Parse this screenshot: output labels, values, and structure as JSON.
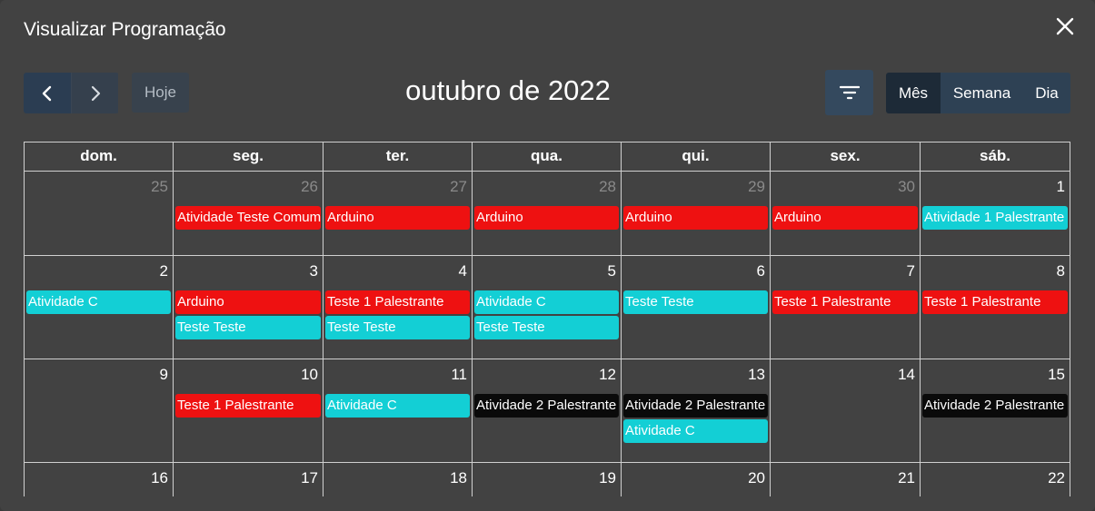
{
  "modal": {
    "title": "Visualizar Programação"
  },
  "toolbar": {
    "today_label": "Hoje",
    "title": "outubro de 2022",
    "views": [
      {
        "label": "Mês",
        "active": true
      },
      {
        "label": "Semana",
        "active": false
      },
      {
        "label": "Dia",
        "active": false
      }
    ]
  },
  "weekdays": [
    "dom.",
    "seg.",
    "ter.",
    "qua.",
    "qui.",
    "sex.",
    "sáb."
  ],
  "colors": {
    "red": "#ee1111",
    "cyan": "#13cfd5",
    "black": "#0a0a0a"
  },
  "weeks": [
    [
      {
        "day": "25",
        "other": true,
        "events": []
      },
      {
        "day": "26",
        "other": true,
        "events": [
          {
            "title": "Atividade Teste Comum",
            "color": "red"
          }
        ]
      },
      {
        "day": "27",
        "other": true,
        "events": [
          {
            "title": "Arduino",
            "color": "red"
          }
        ]
      },
      {
        "day": "28",
        "other": true,
        "events": [
          {
            "title": "Arduino",
            "color": "red"
          }
        ]
      },
      {
        "day": "29",
        "other": true,
        "events": [
          {
            "title": "Arduino",
            "color": "red"
          }
        ]
      },
      {
        "day": "30",
        "other": true,
        "events": [
          {
            "title": "Arduino",
            "color": "red"
          }
        ]
      },
      {
        "day": "1",
        "other": false,
        "events": [
          {
            "title": "Atividade 1 Palestrante",
            "color": "cyan"
          }
        ]
      }
    ],
    [
      {
        "day": "2",
        "other": false,
        "events": [
          {
            "title": "Atividade C",
            "color": "cyan"
          }
        ]
      },
      {
        "day": "3",
        "other": false,
        "events": [
          {
            "title": "Arduino",
            "color": "red"
          },
          {
            "title": "Teste Teste",
            "color": "cyan"
          }
        ]
      },
      {
        "day": "4",
        "other": false,
        "events": [
          {
            "title": "Teste 1 Palestrante",
            "color": "red"
          },
          {
            "title": "Teste Teste",
            "color": "cyan"
          }
        ]
      },
      {
        "day": "5",
        "other": false,
        "events": [
          {
            "title": "Atividade C",
            "color": "cyan"
          },
          {
            "title": "Teste Teste",
            "color": "cyan"
          }
        ]
      },
      {
        "day": "6",
        "other": false,
        "events": [
          {
            "title": "Teste Teste",
            "color": "cyan"
          }
        ]
      },
      {
        "day": "7",
        "other": false,
        "events": [
          {
            "title": "Teste 1 Palestrante",
            "color": "red"
          }
        ]
      },
      {
        "day": "8",
        "other": false,
        "events": [
          {
            "title": "Teste 1 Palestrante",
            "color": "red"
          }
        ]
      }
    ],
    [
      {
        "day": "9",
        "other": false,
        "events": []
      },
      {
        "day": "10",
        "other": false,
        "events": [
          {
            "title": "Teste 1 Palestrante",
            "color": "red"
          }
        ]
      },
      {
        "day": "11",
        "other": false,
        "events": [
          {
            "title": "Atividade C",
            "color": "cyan"
          }
        ]
      },
      {
        "day": "12",
        "other": false,
        "events": [
          {
            "title": "Atividade 2 Palestrante",
            "color": "black"
          }
        ]
      },
      {
        "day": "13",
        "other": false,
        "events": [
          {
            "title": "Atividade 2 Palestrante",
            "color": "black"
          },
          {
            "title": "Atividade C",
            "color": "cyan"
          }
        ]
      },
      {
        "day": "14",
        "other": false,
        "events": []
      },
      {
        "day": "15",
        "other": false,
        "events": [
          {
            "title": "Atividade 2 Palestrante",
            "color": "black"
          }
        ]
      }
    ],
    [
      {
        "day": "16",
        "other": false,
        "events": []
      },
      {
        "day": "17",
        "other": false,
        "events": []
      },
      {
        "day": "18",
        "other": false,
        "events": []
      },
      {
        "day": "19",
        "other": false,
        "events": []
      },
      {
        "day": "20",
        "other": false,
        "events": []
      },
      {
        "day": "21",
        "other": false,
        "events": []
      },
      {
        "day": "22",
        "other": false,
        "events": []
      }
    ]
  ]
}
